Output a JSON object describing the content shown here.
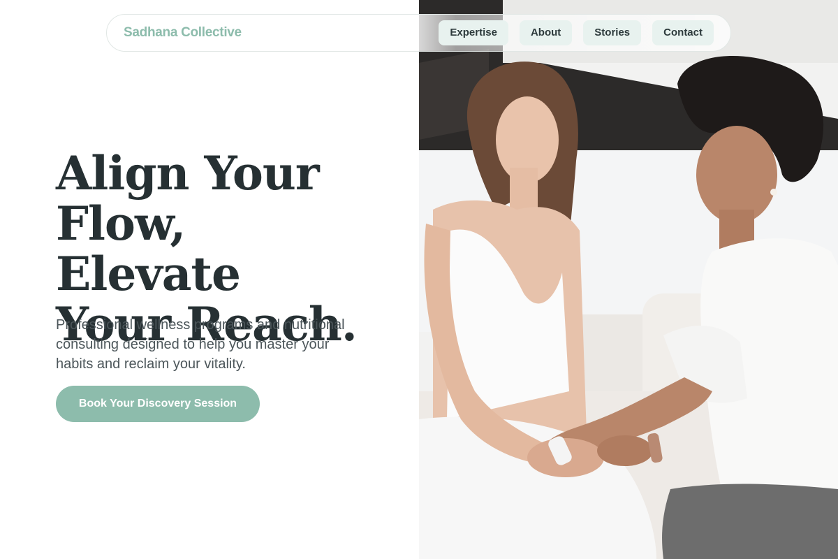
{
  "brand": {
    "name": "Sadhana Collective"
  },
  "nav": {
    "links": [
      "Expertise",
      "About",
      "Stories",
      "Contact"
    ]
  },
  "hero": {
    "headline_line1": "Align Your",
    "headline_line2": "Flow, Elevate",
    "headline_line3": "Your Reach.",
    "subtext": "Professional wellness programs and nutritional consulting designed to help you master your habits and reclaim your vitality.",
    "cta_label": "Book Your Discovery Session"
  },
  "colors": {
    "accent": "#8dbcac",
    "nav_pill_bg": "#e8f2ef",
    "heading": "#263033",
    "body_text": "#4c565a"
  },
  "image": {
    "description_icon": "hero-photo"
  }
}
